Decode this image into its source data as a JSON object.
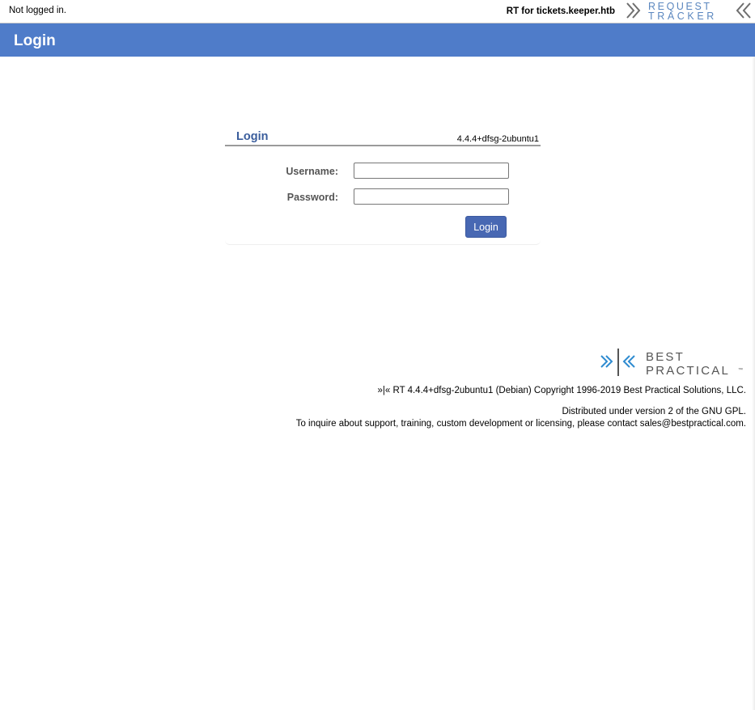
{
  "topbar": {
    "status": "Not logged in.",
    "host": "RT for tickets.keeper.htb",
    "logo": {
      "line1": "REQUEST",
      "line2": "TRACKER",
      "color": "#5b87bf",
      "chevron_color": "#6e6e6e"
    }
  },
  "header": {
    "title": "Login",
    "background": "#4f7cc9"
  },
  "login": {
    "title": "Login",
    "version": "4.4.4+dfsg-2ubuntu1",
    "username_label": "Username:",
    "username_value": "",
    "password_label": "Password:",
    "password_value": "",
    "submit_label": "Login",
    "button_color": "#4868b3"
  },
  "footer": {
    "logo": {
      "line1": "BEST",
      "line2": "PRACTICAL",
      "tm": "™",
      "accent": "#2e8bd0"
    },
    "copyright": "»|« RT 4.4.4+dfsg-2ubuntu1 (Debian) Copyright 1996-2019 Best Practical Solutions, LLC.",
    "license": "Distributed under version 2 of the GNU GPL.",
    "inquire": "To inquire about support, training, custom development or licensing, please contact sales@bestpractical.com."
  }
}
